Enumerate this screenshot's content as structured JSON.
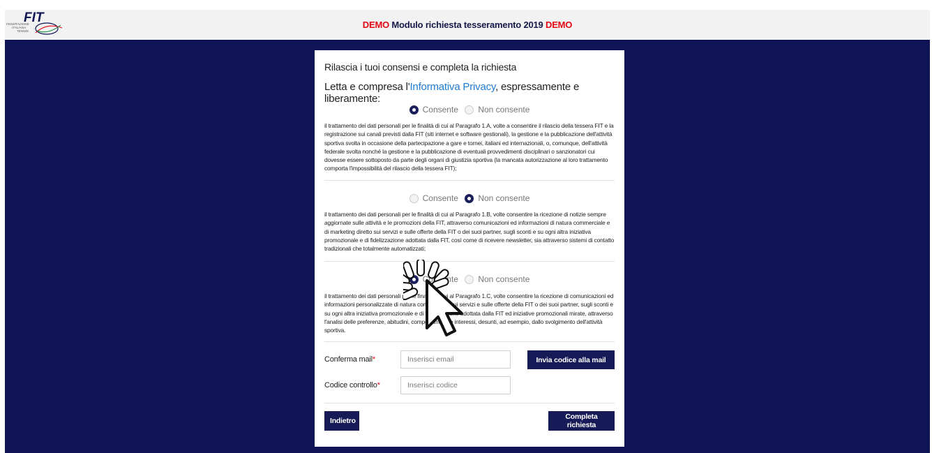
{
  "header": {
    "demo_left": "DEMO",
    "title": " Modulo richiesta tesseramento 2019 ",
    "demo_right": "DEMO",
    "logo_text": "FIT",
    "logo_sub1": "FEDERAZIONE",
    "logo_sub2": "ITALIANA",
    "logo_sub3": "TENNIS"
  },
  "form": {
    "heading": "Rilascia i tuoi consensi e completa la richiesta",
    "privacy_prefix": "Letta e compresa l'",
    "privacy_link": "Informativa Privacy",
    "privacy_suffix": ", espressamente e liberamente:",
    "consents": [
      {
        "option_yes": "Consente",
        "option_no": "Non consente",
        "selected": "yes",
        "text": "il trattamento dei dati personali per le finalità di cui al Paragrafo 1.A, volte a consentire il rilascio della tessera FIT e la registrazione sui canali previsti dalla FIT (siti internet e software gestionali), la gestione e la pubblicazione dell'attività sportiva svolta in occasione della partecipazione a gare e tornei, italiani ed internazionali, o, comunque, dell'attività federale svolta nonché la gestione e la pubblicazione di eventuali provvedimenti disciplinari o sanzionatori cui dovesse essere sottoposto da parte degli organi di giustizia sportiva (la mancata autorizzazione al loro trattamento comporta l'impossibilità del rilascio della tessera FIT);"
      },
      {
        "option_yes": "Consente",
        "option_no": "Non consente",
        "selected": "no",
        "text": "il trattamento dei dati personali per le finalità di cui al Paragrafo 1.B, volte consentire la ricezione di notizie sempre aggiornate sulle attività e le promozioni della FIT, attraverso comunicazioni ed informazioni di natura commerciale e di marketing diretto sui servizi e sulle offerte della FIT o dei suoi partner, sugli sconti e su ogni altra iniziativa promozionale e di fidelizzazione adottata dalla FIT, così come di ricevere newsletter, sia attraverso sistemi di contatto tradizionali che totalmente automatizzati;"
      },
      {
        "option_yes": "Consente",
        "option_no": "Non consente",
        "selected": "yes",
        "text": "il trattamento dei dati personali per le finalità di cui al Paragrafo 1.C, volte consentire la ricezione di comunicazioni ed informazioni personalizzate di natura commerciale sui servizi e sulle offerte della FIT o dei suoi partner, sugli sconti e su ogni altra iniziativa promozionale e di fidelizzazione adottata dalla FIT ed iniziative promozionali mirate, attraverso l'analisi delle preferenze, abitudini, comportamenti e interessi, desunti, ad esempio, dallo svolgimento dell'attività sportiva."
      }
    ],
    "email": {
      "label": "Conferma mail",
      "required_mark": "*",
      "placeholder": "Inserisci email",
      "value": ""
    },
    "send_code_button": "Invia codice alla mail",
    "code": {
      "label": "Codice controllo",
      "required_mark": "*",
      "placeholder": "Inserisci codice",
      "value": ""
    },
    "back_button": "Indietro",
    "complete_button": "Completa richiesta"
  },
  "colors": {
    "navy": "#0e1456",
    "button": "#161a56",
    "demo_red": "#e30613",
    "link_blue": "#1f7bd1"
  }
}
